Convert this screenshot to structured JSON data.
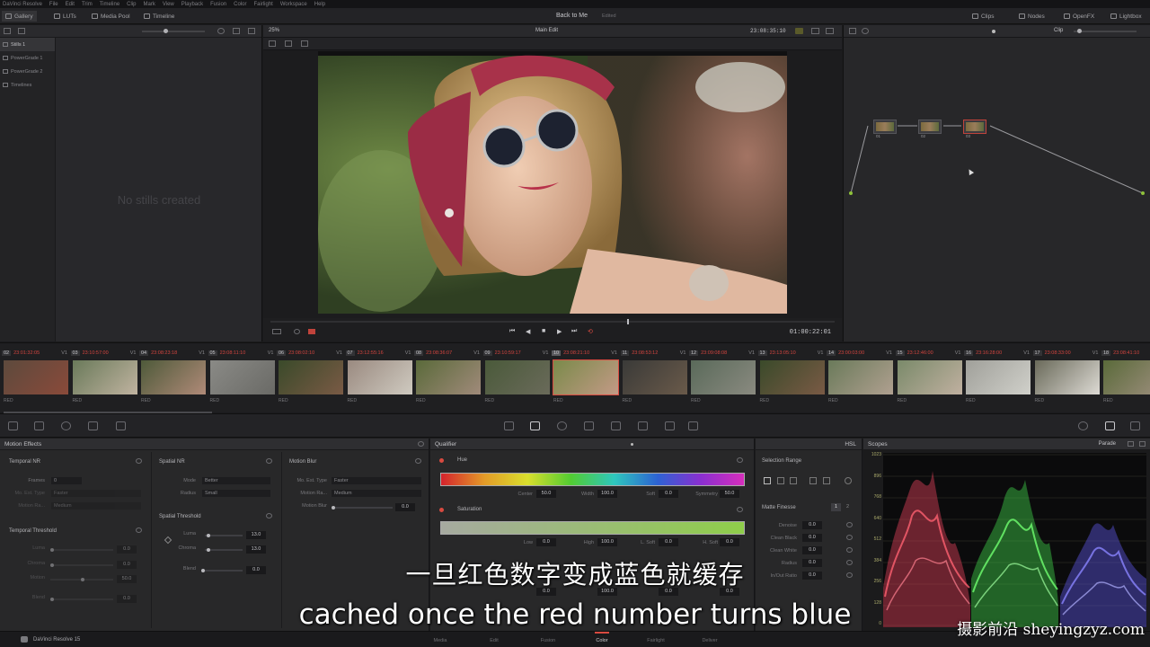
{
  "menubar": [
    "DaVinci Resolve",
    "File",
    "Edit",
    "Trim",
    "Timeline",
    "Clip",
    "Mark",
    "View",
    "Playback",
    "Fusion",
    "Color",
    "Fairlight",
    "Workspace",
    "Help"
  ],
  "toolbar": {
    "gallery": "Gallery",
    "luts": "LUTs",
    "media_pool": "Media Pool",
    "timeline": "Timeline",
    "project_title": "Back to Me",
    "edited": "Edited",
    "clips": "Clips",
    "nodes": "Nodes",
    "openfx": "OpenFX",
    "lightbox": "Lightbox"
  },
  "gallery": {
    "albums": [
      "Stills 1",
      "PowerGrade 1",
      "PowerGrade 2",
      "Timelines"
    ],
    "empty_text": "No stills created"
  },
  "viewer": {
    "zoom": "25%",
    "timeline_name": "Main Edit",
    "source_tc": "23:08:35:10",
    "timecode": "01:00:22:01"
  },
  "node_editor": {
    "mode": "Clip",
    "nodes": [
      "01",
      "02",
      "03"
    ]
  },
  "clips": [
    {
      "num": "02",
      "tc": "23:01:32:05",
      "track": "V1",
      "codec": "RED"
    },
    {
      "num": "03",
      "tc": "23:10:57:00",
      "track": "V1",
      "codec": "RED"
    },
    {
      "num": "04",
      "tc": "23:08:23:18",
      "track": "V1",
      "codec": "RED"
    },
    {
      "num": "05",
      "tc": "23:08:11:10",
      "track": "V1",
      "codec": "RED"
    },
    {
      "num": "06",
      "tc": "23:08:02:10",
      "track": "V1",
      "codec": "RED"
    },
    {
      "num": "07",
      "tc": "23:12:55:16",
      "track": "V1",
      "codec": "RED"
    },
    {
      "num": "08",
      "tc": "23:08:36:07",
      "track": "V1",
      "codec": "RED"
    },
    {
      "num": "09",
      "tc": "23:10:59:17",
      "track": "V1",
      "codec": "RED"
    },
    {
      "num": "10",
      "tc": "23:08:21:10",
      "track": "V1",
      "codec": "RED"
    },
    {
      "num": "11",
      "tc": "23:08:53:12",
      "track": "V1",
      "codec": "RED"
    },
    {
      "num": "12",
      "tc": "23:09:08:08",
      "track": "V1",
      "codec": "RED"
    },
    {
      "num": "13",
      "tc": "23:13:05:10",
      "track": "V1",
      "codec": "RED"
    },
    {
      "num": "14",
      "tc": "23:00:03:00",
      "track": "V1",
      "codec": "RED"
    },
    {
      "num": "15",
      "tc": "23:12:46:00",
      "track": "V1",
      "codec": "RED"
    },
    {
      "num": "16",
      "tc": "23:16:28:00",
      "track": "V1",
      "codec": "RED"
    },
    {
      "num": "17",
      "tc": "23:08:33:00",
      "track": "V1",
      "codec": "RED"
    },
    {
      "num": "18",
      "tc": "23:08:41:10",
      "track": "V1",
      "codec": "RED"
    }
  ],
  "motion_effects": {
    "title": "Motion Effects",
    "temporal_nr": "Temporal NR",
    "frames_label": "Frames",
    "frames_value": "0",
    "mo_est_type_label": "Mo. Est. Type",
    "mo_est_type_value": "Faster",
    "motion_range_label": "Motion Ra...",
    "motion_range_value": "Medium",
    "temporal_threshold": "Temporal Threshold",
    "luma_label": "Luma",
    "luma_value": "0.0",
    "chroma_label": "Chroma",
    "chroma_value": "0.0",
    "motion_label": "Motion",
    "motion_value": "50.0",
    "blend_label": "Blend",
    "blend_value": "0.0",
    "spatial_nr": "Spatial NR",
    "mode_label": "Mode",
    "mode_value": "Better",
    "radius_label": "Radius",
    "radius_value": "Small",
    "spatial_threshold": "Spatial Threshold",
    "sp_luma_label": "Luma",
    "sp_luma_value": "13.0",
    "sp_chroma_label": "Chroma",
    "sp_chroma_value": "13.0",
    "sp_blend_label": "Blend",
    "sp_blend_value": "0.0",
    "motion_blur": "Motion Blur",
    "mb_est_type_label": "Mo. Est. Type",
    "mb_est_type_value": "Faster",
    "mb_range_label": "Motion Ra...",
    "mb_range_value": "Medium",
    "mb_blur_label": "Motion Blur",
    "mb_blur_value": "0.0"
  },
  "qualifier": {
    "title": "Qualifier",
    "mode": "HSL",
    "hue_label": "Hue",
    "center_label": "Center",
    "center_value": "50.0",
    "width_label": "Width",
    "width_value": "100.0",
    "soft_label": "Soft",
    "soft_value": "0.0",
    "symmetry_label": "Symmetry",
    "symmetry_value": "50.0",
    "saturation_label": "Saturation",
    "low_label": "Low",
    "low_value": "0.0",
    "high_label": "High",
    "high_value": "100.0",
    "lsoft_label": "L. Soft",
    "lsoft_value": "0.0",
    "hsoft_label": "H. Soft",
    "hsoft_value": "0.0"
  },
  "selection": {
    "title": "Selection Range",
    "matte_finesse": "Matte Finesse",
    "tabs": [
      "1",
      "2"
    ],
    "rows": [
      {
        "label": "Denoise",
        "value": "0.0"
      },
      {
        "label": "Clean Black",
        "value": "0.0"
      },
      {
        "label": "Clean White",
        "value": "0.0"
      },
      {
        "label": "Radius",
        "value": "0.0"
      },
      {
        "label": "In/Out Ratio",
        "value": "0.0"
      }
    ]
  },
  "scopes": {
    "title": "Scopes",
    "mode": "Parade",
    "ticks": [
      "1023",
      "896",
      "768",
      "640",
      "512",
      "384",
      "256",
      "128",
      "0"
    ]
  },
  "bottombar": {
    "app": "DaVinci Resolve 15",
    "pages": [
      "Media",
      "Edit",
      "Fusion",
      "Color",
      "Fairlight",
      "Deliver"
    ],
    "active_page": "Color"
  },
  "subtitles": {
    "cn": "一旦红色数字变成蓝色就缓存",
    "en": "cached once the red number turns blue"
  },
  "watermark": "摄影前沿 sheyingzyz.com"
}
